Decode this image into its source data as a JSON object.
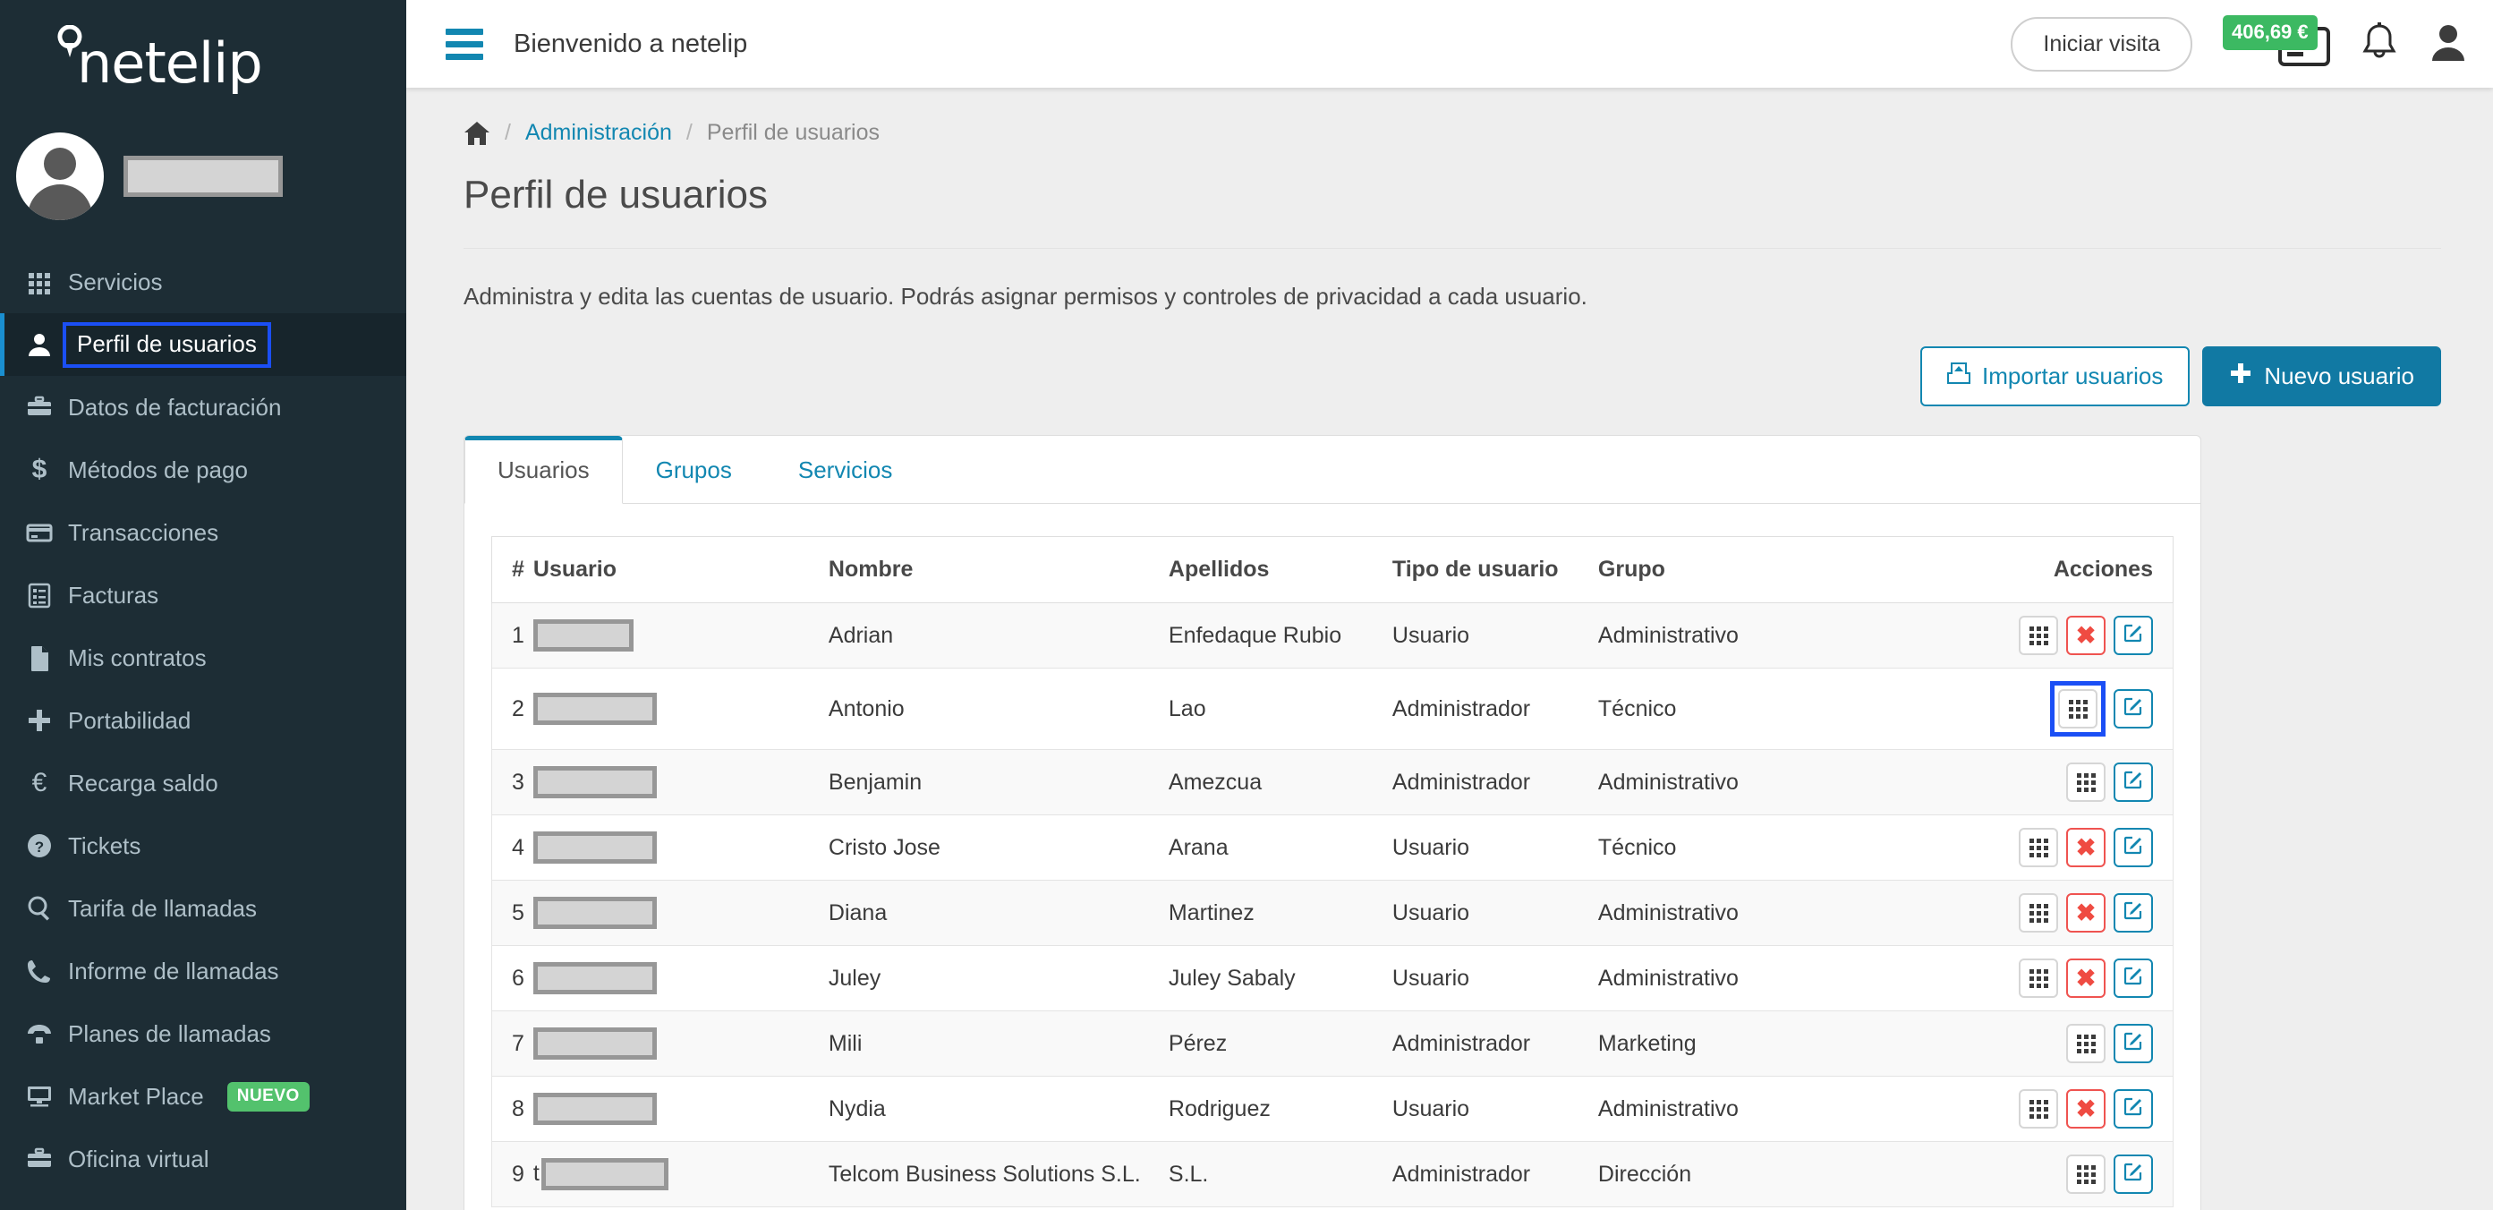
{
  "brand": {
    "name": "netelip",
    "logo_icon": "location-pin-icon"
  },
  "sidebar": {
    "profile": {
      "avatar_icon": "user-avatar-icon",
      "name_redacted": ""
    },
    "items": [
      {
        "label": "Servicios",
        "icon": "grid-icon",
        "active": false,
        "badge": ""
      },
      {
        "label": "Perfil de usuarios",
        "icon": "user-icon",
        "active": true,
        "badge": ""
      },
      {
        "label": "Datos de facturación",
        "icon": "briefcase-icon",
        "active": false,
        "badge": ""
      },
      {
        "label": "Métodos de pago",
        "icon": "dollar-icon",
        "active": false,
        "badge": ""
      },
      {
        "label": "Transacciones",
        "icon": "credit-card-icon",
        "active": false,
        "badge": ""
      },
      {
        "label": "Facturas",
        "icon": "invoice-list-icon",
        "active": false,
        "badge": ""
      },
      {
        "label": "Mis contratos",
        "icon": "document-icon",
        "active": false,
        "badge": ""
      },
      {
        "label": "Portabilidad",
        "icon": "plus-icon",
        "active": false,
        "badge": ""
      },
      {
        "label": "Recarga saldo",
        "icon": "euro-icon",
        "active": false,
        "badge": ""
      },
      {
        "label": "Tickets",
        "icon": "help-circle-icon",
        "active": false,
        "badge": ""
      },
      {
        "label": "Tarifa de llamadas",
        "icon": "search-icon",
        "active": false,
        "badge": ""
      },
      {
        "label": "Informe de llamadas",
        "icon": "phone-icon",
        "active": false,
        "badge": ""
      },
      {
        "label": "Planes de llamadas",
        "icon": "telephone-icon",
        "active": false,
        "badge": ""
      },
      {
        "label": "Market Place",
        "icon": "desktop-icon",
        "active": false,
        "badge": "NUEVO"
      },
      {
        "label": "Oficina virtual",
        "icon": "briefcase-icon",
        "active": false,
        "badge": ""
      }
    ]
  },
  "topbar": {
    "menu_icon": "hamburger-icon",
    "title": "Bienvenido a netelip",
    "visit_button": "Iniciar visita",
    "balance": "406,69 €",
    "balance_icon": "credit-card-icon",
    "bell_icon": "bell-icon",
    "account_icon": "user-account-icon"
  },
  "breadcrumb": {
    "home_icon": "home-icon",
    "separator": "/",
    "parent": "Administración",
    "current": "Perfil de usuarios"
  },
  "page": {
    "title": "Perfil de usuarios",
    "description": "Administra y edita las cuentas de usuario. Podrás asignar permisos y controles de privacidad a cada usuario."
  },
  "actions": {
    "import_label": "Importar usuarios",
    "import_icon": "import-icon",
    "new_label": "Nuevo usuario",
    "new_icon": "plus-icon"
  },
  "tabs": [
    {
      "label": "Usuarios",
      "active": true
    },
    {
      "label": "Grupos",
      "active": false
    },
    {
      "label": "Servicios",
      "active": false
    }
  ],
  "table": {
    "headers": [
      "#",
      "Usuario",
      "Nombre",
      "Apellidos",
      "Tipo de usuario",
      "Grupo",
      "Acciones"
    ],
    "rows": [
      {
        "num": "1",
        "usuario_prefix": "",
        "usuario_redacted_width": 112,
        "nombre": "Adrian",
        "apellidos": "Enfedaque Rubio",
        "tipo": "Usuario",
        "grupo": "Administrativo",
        "has_delete": true,
        "focused_action": ""
      },
      {
        "num": "2",
        "usuario_prefix": "",
        "usuario_redacted_width": 138,
        "nombre": "Antonio",
        "apellidos": "Lao",
        "tipo": "Administrador",
        "grupo": "Técnico",
        "has_delete": false,
        "focused_action": "grid"
      },
      {
        "num": "3",
        "usuario_prefix": "",
        "usuario_redacted_width": 138,
        "nombre": "Benjamin",
        "apellidos": "Amezcua",
        "tipo": "Administrador",
        "grupo": "Administrativo",
        "has_delete": false,
        "focused_action": ""
      },
      {
        "num": "4",
        "usuario_prefix": "",
        "usuario_redacted_width": 138,
        "nombre": "Cristo Jose",
        "apellidos": "Arana",
        "tipo": "Usuario",
        "grupo": "Técnico",
        "has_delete": true,
        "focused_action": ""
      },
      {
        "num": "5",
        "usuario_prefix": "",
        "usuario_redacted_width": 138,
        "nombre": "Diana",
        "apellidos": "Martinez",
        "tipo": "Usuario",
        "grupo": "Administrativo",
        "has_delete": true,
        "focused_action": ""
      },
      {
        "num": "6",
        "usuario_prefix": "",
        "usuario_redacted_width": 138,
        "nombre": "Juley",
        "apellidos": "Juley Sabaly",
        "tipo": "Usuario",
        "grupo": "Administrativo",
        "has_delete": true,
        "focused_action": ""
      },
      {
        "num": "7",
        "usuario_prefix": "",
        "usuario_redacted_width": 138,
        "nombre": "Mili",
        "apellidos": "Pérez",
        "tipo": "Administrador",
        "grupo": "Marketing",
        "has_delete": false,
        "focused_action": ""
      },
      {
        "num": "8",
        "usuario_prefix": "",
        "usuario_redacted_width": 138,
        "nombre": "Nydia",
        "apellidos": "Rodriguez",
        "tipo": "Usuario",
        "grupo": "Administrativo",
        "has_delete": true,
        "focused_action": ""
      },
      {
        "num": "9",
        "usuario_prefix": "t",
        "usuario_redacted_width": 142,
        "nombre": "Telcom Business Solutions S.L.",
        "apellidos": "S.L.",
        "tipo": "Administrador",
        "grupo": "Dirección",
        "has_delete": false,
        "focused_action": ""
      }
    ],
    "action_icons": {
      "grid": "grid-dots-icon",
      "delete": "close-x-icon",
      "edit": "edit-square-icon"
    },
    "delete_glyph": "✖"
  },
  "colors": {
    "sidebar_bg": "#1d2d35",
    "accent_blue": "#1287b1",
    "primary_button": "#1179a3",
    "focus_outline": "#1b4ff5",
    "badge_green": "#53c26d",
    "balance_green": "#3cb962",
    "danger_red": "#ef5350"
  }
}
